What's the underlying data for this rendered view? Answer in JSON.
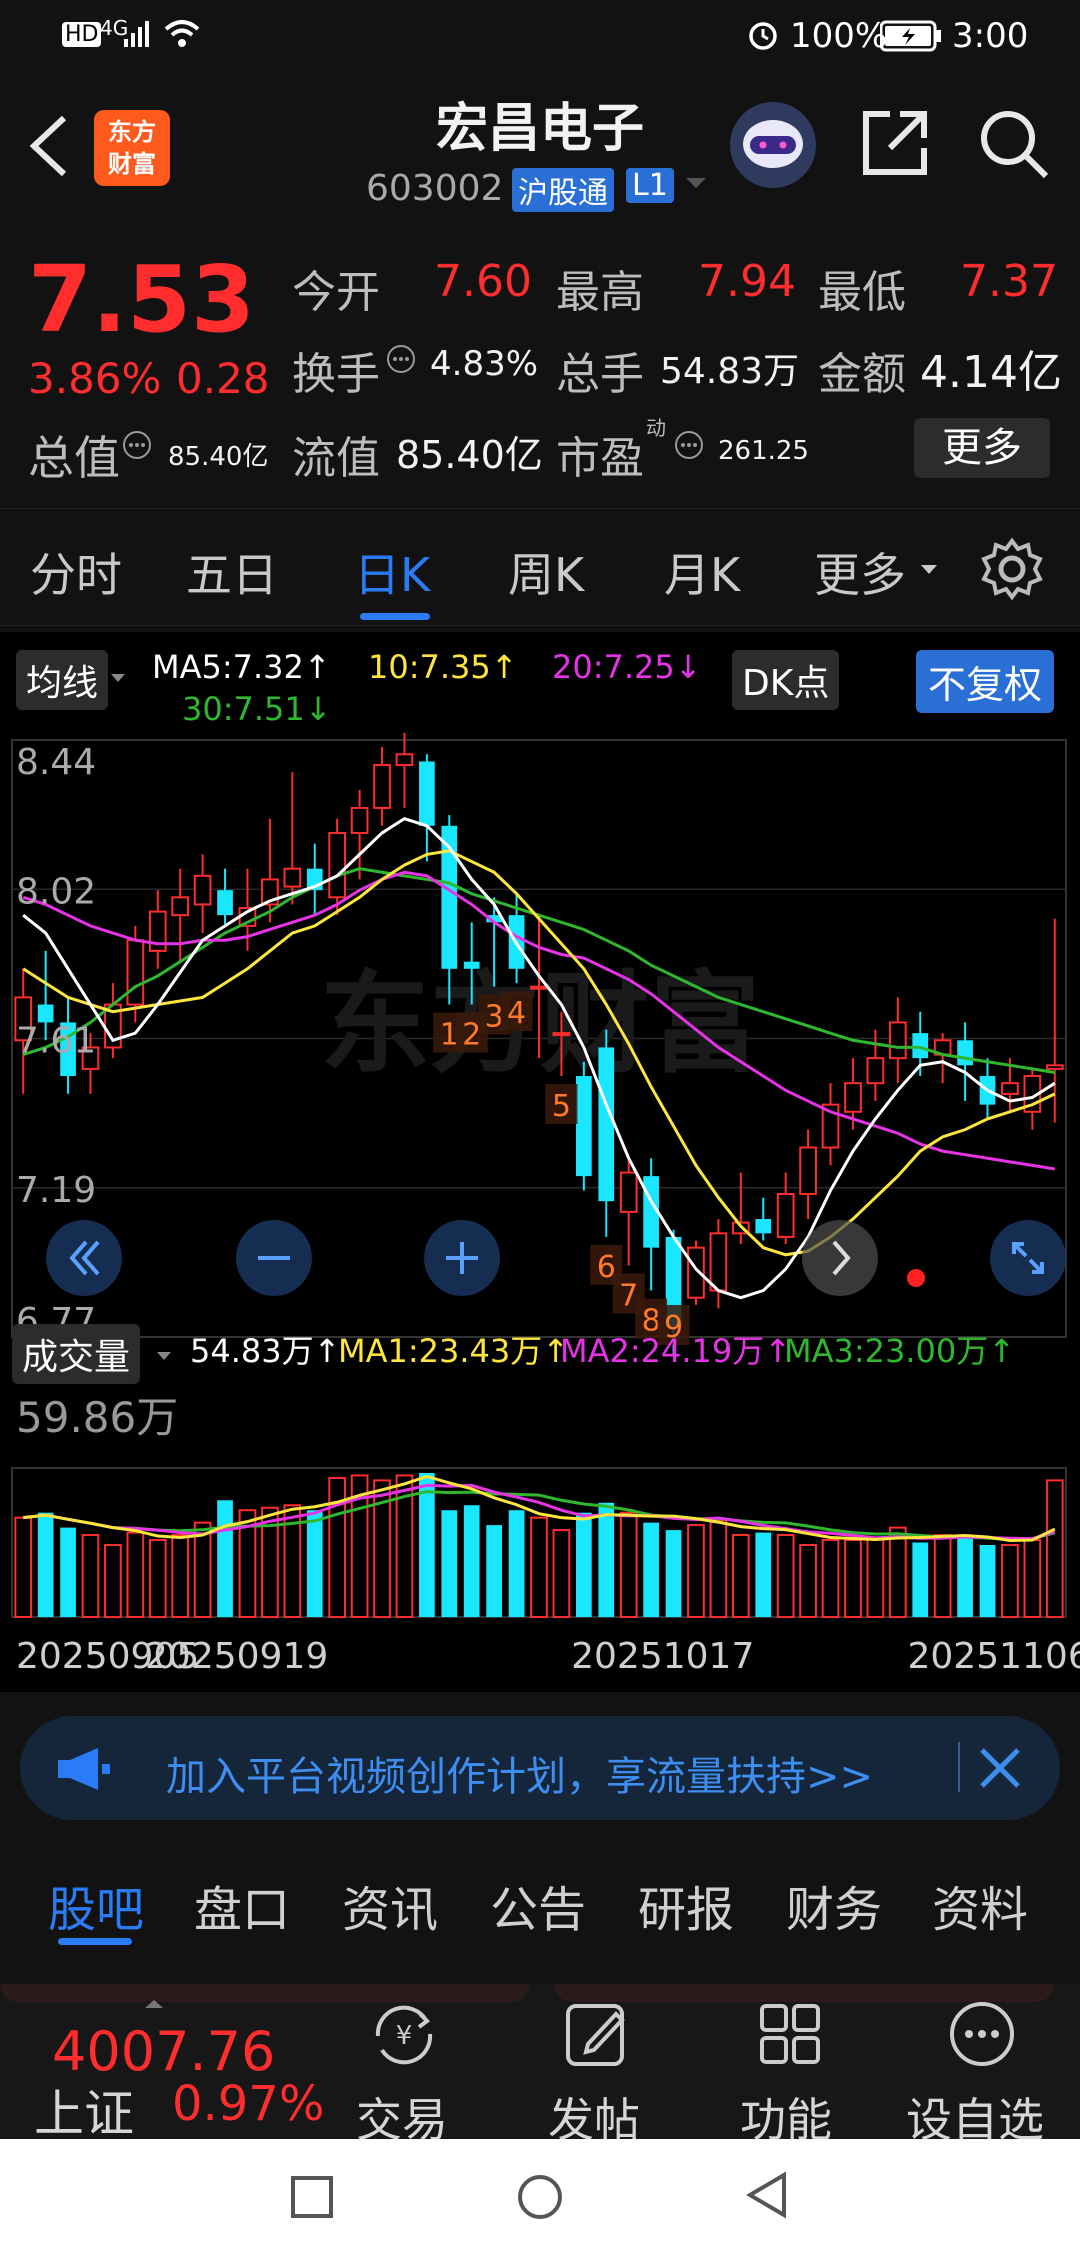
{
  "status_bar": {
    "network": "4G",
    "battery": "100%",
    "time": "3:00"
  },
  "header": {
    "logo_text_line1": "东方",
    "logo_text_line2": "财富",
    "title": "宏昌电子",
    "code": "603002",
    "badge_connect": "沪股通",
    "badge_level": "L1"
  },
  "quote": {
    "price": "7.53",
    "change_pct": "3.86%",
    "change": "0.28",
    "open_label": "今开",
    "open": "7.60",
    "high_label": "最高",
    "high": "7.94",
    "low_label": "最低",
    "low": "7.37",
    "turnover_label": "换手",
    "turnover": "4.83%",
    "volume_label": "总手",
    "volume": "54.83万",
    "amount_label": "金额",
    "amount": "4.14亿",
    "mktcap_label": "总值",
    "mktcap": "85.40亿",
    "float_label": "流值",
    "float": "85.40亿",
    "pe_label": "市盈",
    "pe_sup": "动",
    "pe": "261.25",
    "more": "更多"
  },
  "tabs": [
    "分时",
    "五日",
    "日K",
    "周K",
    "月K",
    "更多"
  ],
  "active_tab": "日K",
  "chart_header": {
    "ma_selector": "均线",
    "ma5": "MA5:7.32↑",
    "ma10": "10:7.35↑",
    "ma20": "20:7.25↓",
    "ma30": "30:7.51↓",
    "dk": "DK点",
    "adjust": "不复权"
  },
  "volume_header": {
    "selector": "成交量",
    "vol": "54.83万↑",
    "ma1": "MA1:23.43万↑",
    "ma2": "MA2:24.19万↑",
    "ma3": "MA3:23.00万↑",
    "max_label": "59.86万"
  },
  "colors": {
    "up": "#ff2d2d",
    "down": "#19e6ff",
    "ma5": "#ffffff",
    "ma10": "#ffe63c",
    "ma20": "#e633e6",
    "ma30": "#2fb82f",
    "accent": "#2a7cf6"
  },
  "chart_data": {
    "type": "candlestick",
    "y_ticks": [
      "8.44",
      "8.02",
      "7.61",
      "7.19",
      "6.77"
    ],
    "ylim": [
      6.77,
      8.44
    ],
    "x_ticks": [
      "20250905",
      "20250919",
      "20251017",
      "20251106"
    ],
    "candles": [
      [
        7.6,
        7.8,
        7.45,
        7.72
      ],
      [
        7.7,
        7.85,
        7.6,
        7.65
      ],
      [
        7.65,
        7.72,
        7.45,
        7.5
      ],
      [
        7.52,
        7.62,
        7.45,
        7.58
      ],
      [
        7.58,
        7.76,
        7.55,
        7.7
      ],
      [
        7.7,
        7.92,
        7.65,
        7.88
      ],
      [
        7.85,
        8.02,
        7.8,
        7.96
      ],
      [
        7.95,
        8.08,
        7.82,
        8.0
      ],
      [
        7.98,
        8.12,
        7.9,
        8.06
      ],
      [
        8.02,
        8.08,
        7.92,
        7.95
      ],
      [
        7.92,
        8.08,
        7.85,
        7.97
      ],
      [
        7.98,
        8.22,
        7.93,
        8.05
      ],
      [
        8.03,
        8.35,
        7.98,
        8.08
      ],
      [
        8.08,
        8.15,
        7.95,
        8.02
      ],
      [
        8.0,
        8.22,
        7.95,
        8.18
      ],
      [
        8.18,
        8.3,
        8.05,
        8.25
      ],
      [
        8.25,
        8.42,
        8.2,
        8.37
      ],
      [
        8.37,
        8.46,
        8.25,
        8.4
      ],
      [
        8.38,
        8.4,
        8.1,
        8.2
      ],
      [
        8.2,
        8.23,
        7.7,
        7.8
      ],
      [
        7.82,
        7.93,
        7.7,
        7.8
      ],
      [
        7.95,
        8.0,
        7.75,
        7.93
      ],
      [
        7.95,
        8.01,
        7.76,
        7.8
      ],
      [
        7.75,
        7.95,
        7.55,
        7.75
      ],
      [
        7.62,
        7.68,
        7.5,
        7.62
      ],
      [
        7.5,
        7.54,
        7.18,
        7.22
      ],
      [
        7.58,
        7.63,
        7.05,
        7.15
      ],
      [
        7.12,
        7.27,
        6.97,
        7.23
      ],
      [
        7.22,
        7.27,
        6.9,
        7.02
      ],
      [
        7.05,
        7.07,
        6.72,
        6.8
      ],
      [
        6.88,
        7.04,
        6.86,
        7.02
      ],
      [
        6.9,
        7.1,
        6.85,
        7.06
      ],
      [
        7.06,
        7.23,
        7.03,
        7.09
      ],
      [
        7.1,
        7.16,
        7.04,
        7.06
      ],
      [
        7.05,
        7.23,
        7.03,
        7.17
      ],
      [
        7.17,
        7.35,
        7.1,
        7.3
      ],
      [
        7.3,
        7.48,
        7.25,
        7.42
      ],
      [
        7.4,
        7.55,
        7.35,
        7.48
      ],
      [
        7.48,
        7.63,
        7.43,
        7.55
      ],
      [
        7.55,
        7.72,
        7.48,
        7.65
      ],
      [
        7.62,
        7.68,
        7.5,
        7.55
      ],
      [
        7.56,
        7.62,
        7.48,
        7.6
      ],
      [
        7.6,
        7.65,
        7.43,
        7.53
      ],
      [
        7.5,
        7.55,
        7.38,
        7.42
      ],
      [
        7.45,
        7.55,
        7.4,
        7.48
      ],
      [
        7.4,
        7.52,
        7.35,
        7.5
      ],
      [
        7.52,
        7.94,
        7.37,
        7.53
      ]
    ],
    "volumes": [
      40,
      42,
      36,
      33,
      29,
      34,
      31,
      33,
      38,
      47,
      43,
      44,
      45,
      43,
      56,
      57,
      55,
      57,
      58,
      43,
      45,
      37,
      43,
      40,
      35,
      42,
      46,
      42,
      38,
      35,
      37,
      39,
      33,
      34,
      33,
      29,
      31,
      31,
      32,
      36,
      30,
      33,
      33,
      29,
      29,
      31,
      55
    ],
    "ma5": [
      7.95,
      7.9,
      7.8,
      7.7,
      7.6,
      7.62,
      7.7,
      7.79,
      7.88,
      7.92,
      7.96,
      7.99,
      8.01,
      8.03,
      8.06,
      8.12,
      8.18,
      8.22,
      8.2,
      8.14,
      8.05,
      7.98,
      7.87,
      7.78,
      7.7,
      7.58,
      7.42,
      7.27,
      7.15,
      7.05,
      6.96,
      6.9,
      6.88,
      6.9,
      6.96,
      7.05,
      7.18,
      7.29,
      7.38,
      7.46,
      7.53,
      7.54,
      7.51,
      7.46,
      7.43,
      7.44,
      7.48
    ],
    "ma10": [
      7.8,
      7.76,
      7.72,
      7.7,
      7.68,
      7.69,
      7.7,
      7.71,
      7.72,
      7.76,
      7.8,
      7.85,
      7.9,
      7.92,
      7.96,
      8.0,
      8.05,
      8.09,
      8.12,
      8.13,
      8.1,
      8.07,
      8.01,
      7.94,
      7.87,
      7.8,
      7.7,
      7.59,
      7.47,
      7.36,
      7.25,
      7.16,
      7.08,
      7.02,
      7.0,
      7.01,
      7.05,
      7.1,
      7.16,
      7.22,
      7.29,
      7.33,
      7.35,
      7.38,
      7.4,
      7.42,
      7.45
    ],
    "ma20": [
      8.0,
      7.98,
      7.95,
      7.92,
      7.9,
      7.88,
      7.87,
      7.87,
      7.88,
      7.88,
      7.89,
      7.91,
      7.93,
      7.95,
      7.98,
      8.02,
      8.05,
      8.07,
      8.06,
      8.02,
      7.98,
      7.93,
      7.89,
      7.86,
      7.84,
      7.83,
      7.8,
      7.77,
      7.73,
      7.68,
      7.63,
      7.58,
      7.54,
      7.5,
      7.46,
      7.43,
      7.4,
      7.38,
      7.36,
      7.34,
      7.31,
      7.29,
      7.28,
      7.27,
      7.26,
      7.25,
      7.24
    ],
    "ma30": [
      7.56,
      7.58,
      7.61,
      7.65,
      7.7,
      7.75,
      7.78,
      7.82,
      7.86,
      7.9,
      7.93,
      7.96,
      8.0,
      8.03,
      8.06,
      8.08,
      8.07,
      8.06,
      8.05,
      8.04,
      8.01,
      7.99,
      7.97,
      7.95,
      7.93,
      7.91,
      7.88,
      7.85,
      7.81,
      7.78,
      7.75,
      7.72,
      7.7,
      7.68,
      7.66,
      7.64,
      7.62,
      7.6,
      7.59,
      7.58,
      7.58,
      7.56,
      7.55,
      7.54,
      7.53,
      7.52,
      7.51
    ],
    "annotations": [
      {
        "label": "1",
        "index": 19
      },
      {
        "label": "2",
        "index": 20
      },
      {
        "label": "3",
        "index": 21
      },
      {
        "label": "4",
        "index": 22
      },
      {
        "label": "5",
        "index": 24
      },
      {
        "label": "6",
        "index": 26
      },
      {
        "label": "7",
        "index": 27
      },
      {
        "label": "8",
        "index": 28
      },
      {
        "label": "9",
        "index": 29
      }
    ]
  },
  "banner": {
    "text": "加入平台视频创作计划，享流量扶持>>"
  },
  "sub_tabs": [
    "股吧",
    "盘口",
    "资讯",
    "公告",
    "研报",
    "财务",
    "资料"
  ],
  "active_sub_tab": "股吧",
  "bottom_bar": {
    "index_value": "4007.76",
    "index_name": "上证",
    "index_change": "0.97%",
    "trade": "交易",
    "post": "发帖",
    "function": "功能",
    "watchlist": "设自选"
  }
}
